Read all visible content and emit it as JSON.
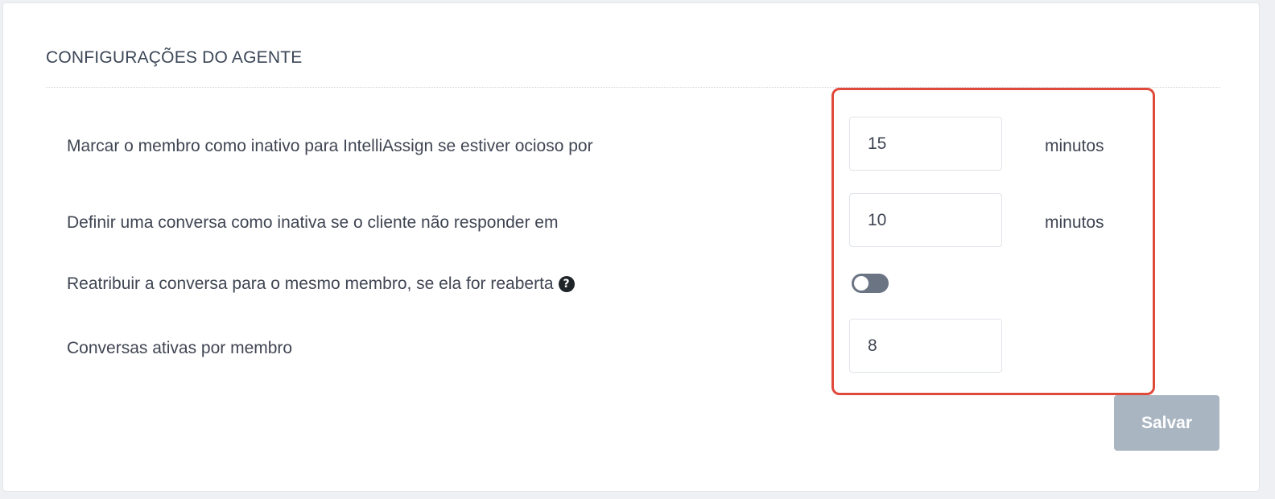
{
  "section": {
    "title": "CONFIGURAÇÕES DO AGENTE"
  },
  "settings": {
    "idle": {
      "label": "Marcar o membro como inativo para IntelliAssign se estiver ocioso por",
      "value": "15",
      "unit": "minutos"
    },
    "inactive_conversation": {
      "label": "Definir uma conversa como inativa se o cliente não responder em",
      "value": "10",
      "unit": "minutos"
    },
    "reassign": {
      "label": "Reatribuir a conversa para o mesmo membro, se ela for reaberta",
      "enabled": false,
      "help_icon": "question-circle-icon"
    },
    "active_per_member": {
      "label": "Conversas ativas por membro",
      "value": "8"
    }
  },
  "actions": {
    "save_label": "Salvar"
  },
  "colors": {
    "highlight": "#e04a3b",
    "save_disabled": "#a9b5c1",
    "toggle_off": "#6b7483"
  }
}
